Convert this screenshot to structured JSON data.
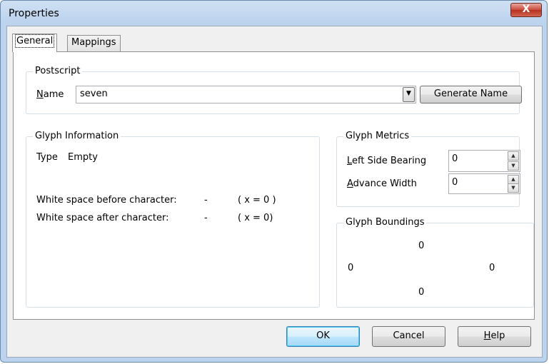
{
  "window": {
    "title": "Properties",
    "close_glyph": "X"
  },
  "tabs": [
    {
      "label": "General",
      "active": true
    },
    {
      "label": "Mappings",
      "active": false
    }
  ],
  "postscript": {
    "legend": "Postscript",
    "name_label_accel": "N",
    "name_label_rest": "ame",
    "name_value": "seven",
    "generate_button": "Generate Name"
  },
  "glyph_info": {
    "legend": "Glyph Information",
    "type_label": "Type",
    "type_value": "Empty",
    "ws_before_label": "White space before character:",
    "ws_before_dash": "-",
    "ws_before_x": "( x = 0 )",
    "ws_after_label": "White space after character:",
    "ws_after_dash": "-",
    "ws_after_x": "( x = 0)"
  },
  "glyph_metrics": {
    "legend": "Glyph Metrics",
    "lsb_accel": "L",
    "lsb_rest": "eft Side Bearing",
    "lsb_value": "0",
    "aw_accel": "A",
    "aw_rest": "dvance Width",
    "aw_value": "0"
  },
  "glyph_boundings": {
    "legend": "Glyph Boundings",
    "top": "0",
    "left": "0",
    "right": "0",
    "bottom": "0"
  },
  "buttons": {
    "ok": "OK",
    "cancel": "Cancel",
    "help_accel": "H",
    "help_rest": "elp"
  }
}
